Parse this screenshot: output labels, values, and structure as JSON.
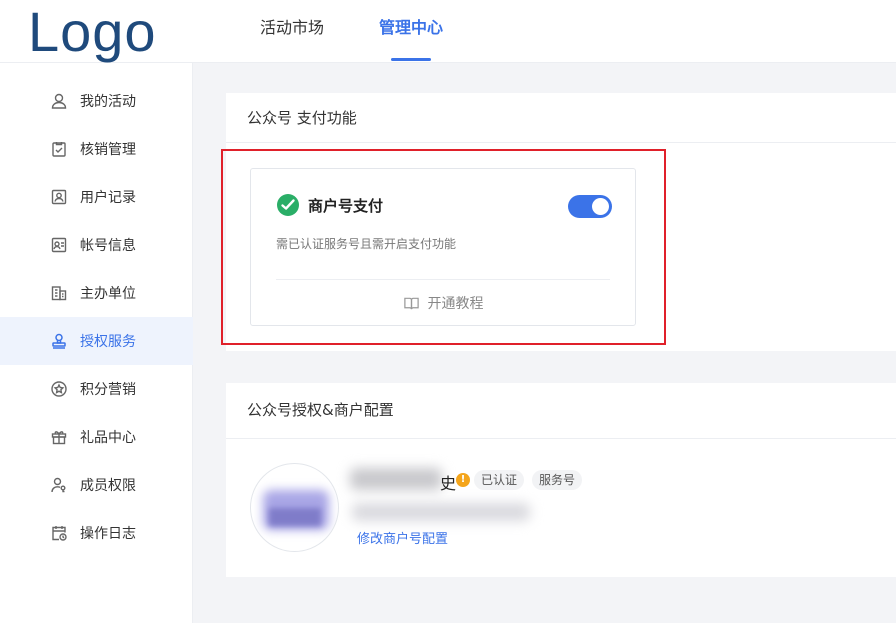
{
  "header": {
    "logo_text": "Logo",
    "tabs": [
      {
        "label": "活动市场",
        "active": false
      },
      {
        "label": "管理中心",
        "active": true
      }
    ]
  },
  "sidebar": {
    "items": [
      {
        "label": "我的活动",
        "icon": "user-icon"
      },
      {
        "label": "核销管理",
        "icon": "clipboard-check-icon"
      },
      {
        "label": "用户记录",
        "icon": "user-record-icon"
      },
      {
        "label": "帐号信息",
        "icon": "id-card-icon"
      },
      {
        "label": "主办单位",
        "icon": "building-icon"
      },
      {
        "label": "授权服务",
        "icon": "stamp-icon",
        "active": true
      },
      {
        "label": "积分营销",
        "icon": "star-circle-icon"
      },
      {
        "label": "礼品中心",
        "icon": "gift-icon"
      },
      {
        "label": "成员权限",
        "icon": "user-key-icon"
      },
      {
        "label": "操作日志",
        "icon": "calendar-log-icon"
      }
    ]
  },
  "pay_section": {
    "title": "公众号 支付功能",
    "card": {
      "title": "商户号支付",
      "description": "需已认证服务号且需开启支付功能",
      "tutorial_label": "开通教程",
      "toggle_on": true
    }
  },
  "auth_section": {
    "title": "公众号授权&商户配置",
    "account_name_visible": "史",
    "tags": [
      "已认证",
      "服务号"
    ],
    "edit_link": "修改商户号配置"
  },
  "colors": {
    "accent": "#3b73e8",
    "wechat_green": "#2aae67",
    "highlight_red": "#e0202a",
    "warning": "#f4a51c"
  }
}
